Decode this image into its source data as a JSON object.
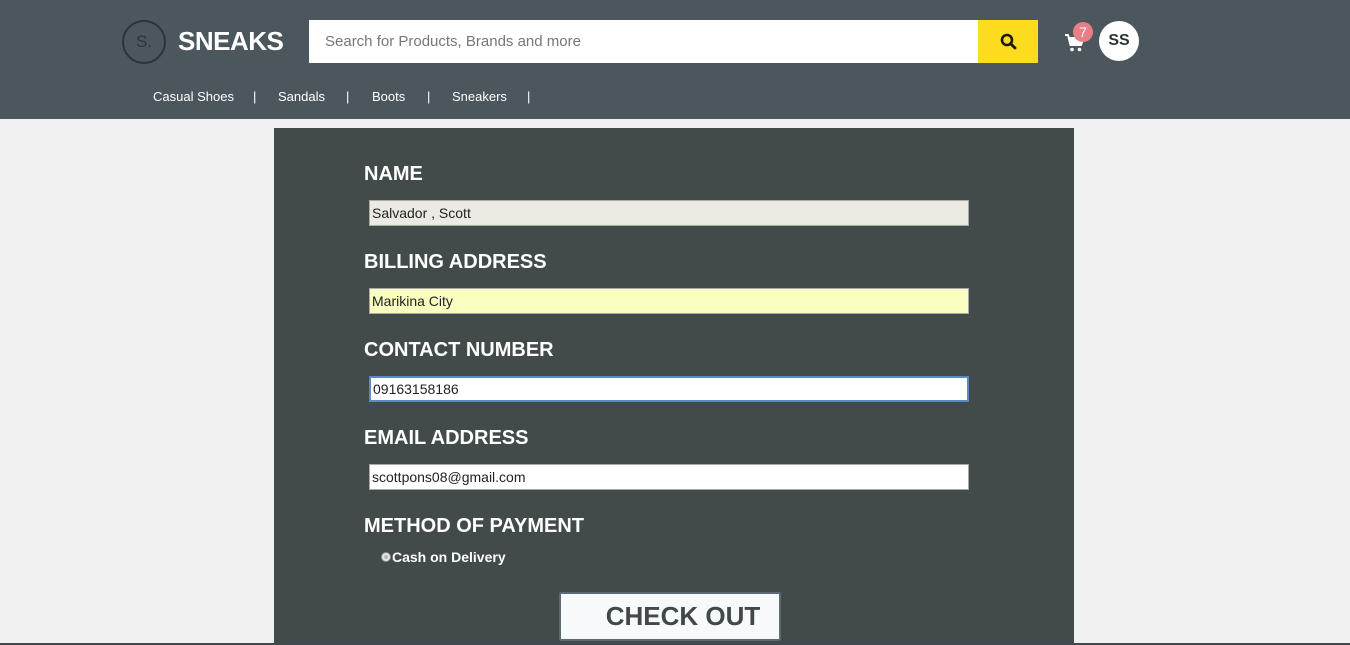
{
  "header": {
    "logo_mark": "S.",
    "logo_text": "SNEAKS",
    "search": {
      "placeholder": "Search for Products, Brands and more",
      "value": ""
    },
    "search_button_icon": "search-icon",
    "cart_icon": "cart-icon",
    "cart_count": "7",
    "avatar_initials": "SS"
  },
  "nav": {
    "items": [
      {
        "label": "Casual Shoes"
      },
      {
        "label": "Sandals"
      },
      {
        "label": "Boots"
      },
      {
        "label": "Sneakers"
      }
    ],
    "separator": "|"
  },
  "form": {
    "name_label": "NAME",
    "name_value": "Salvador , Scott",
    "address_label": "BILLING ADDRESS",
    "address_value": "Marikina City",
    "contact_label": "CONTACT NUMBER",
    "contact_value": "09163158186",
    "email_label": "EMAIL ADDRESS",
    "email_value": "scottpons08@gmail.com",
    "payment_label": "METHOD OF PAYMENT",
    "payment_option": "Cash on Delivery",
    "checkout_label": "CHECK OUT"
  },
  "colors": {
    "header_bg": "#4b575d",
    "search_button": "#fbdc1e",
    "badge": "#ea7e86",
    "panel_bg": "#434a4a",
    "page_bg": "#f1f1f1",
    "address_field_bg": "#fafdc0",
    "focus_border": "#5b88c6"
  }
}
